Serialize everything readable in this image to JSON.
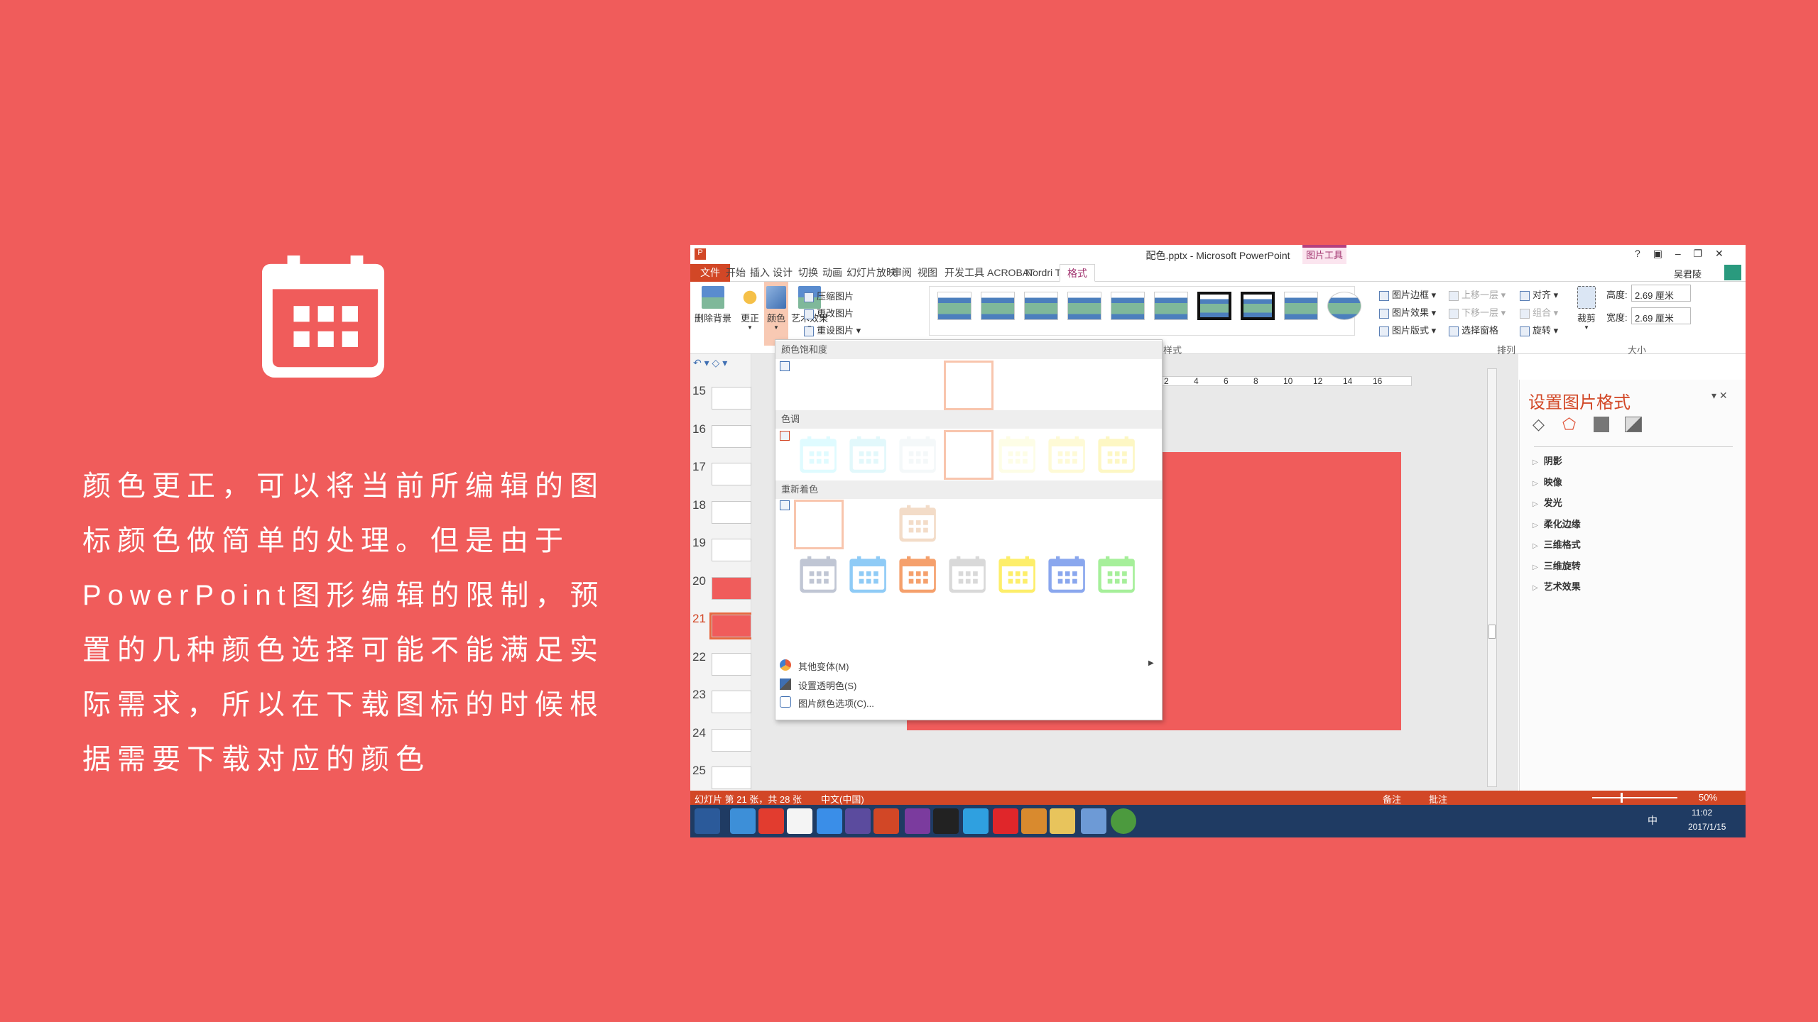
{
  "left": {
    "icon": "calendar-icon",
    "lines": [
      "颜色更正，可以将当前所编辑的图",
      "标颜色做简单的处理。但是由于",
      "PowerPoint图形编辑的限制，预",
      "置的几种颜色选择可能不能满足实",
      "际需求，所以在下载图标的时候根",
      "据需要下载对应的颜色"
    ]
  },
  "window": {
    "title": "配色.pptx - Microsoft PowerPoint",
    "context_tab": "图片工具",
    "controls": [
      "?",
      "▣",
      "–",
      "❐",
      "✕"
    ],
    "user": "吴君陵",
    "tabs": [
      "文件",
      "开始",
      "插入",
      "设计",
      "切换",
      "动画",
      "幻灯片放映",
      "审阅",
      "视图",
      "开发工具",
      "ACROBAT",
      "Nordri Tools",
      "格式"
    ],
    "ribbon": {
      "remove_bg": "删除背景",
      "corrections": "更正",
      "color": "颜色",
      "artistic": "艺术效果",
      "compress": "压缩图片",
      "change": "更改图片",
      "reset": "重设图片",
      "border": "图片边框",
      "effects": "图片效果",
      "layout": "图片版式",
      "forward": "上移一层",
      "backward": "下移一层",
      "selection": "选择窗格",
      "align": "对齐",
      "group": "组合",
      "rotate": "旋转",
      "crop": "裁剪",
      "height_label": "高度:",
      "height_value": "2.69 厘米",
      "width_label": "宽度:",
      "width_value": "2.69 厘米",
      "group_styles": "图片样式",
      "group_arrange": "排列",
      "group_size": "大小"
    },
    "ruler": [
      "2",
      "4",
      "6",
      "8",
      "10",
      "12",
      "14",
      "16"
    ],
    "slides": [
      "15",
      "16",
      "17",
      "18",
      "19",
      "20",
      "21",
      "22",
      "23",
      "24",
      "25"
    ],
    "current_slide": "21",
    "color_menu": {
      "saturation": "颜色饱和度",
      "tone": "色调",
      "recolor": "重新着色",
      "tone_colors": [
        "#dffbff",
        "#e2f8fb",
        "#f4f8f9",
        "",
        "#fdfde6",
        "#fefad6",
        "#fdf7c4"
      ],
      "recolor_top": "#f3dcc8",
      "recolor_colors": [
        "#c0c6d4",
        "#8fcbf6",
        "#f5a06c",
        "#d9d9d9",
        "#fdee6a",
        "#8aa7ee",
        "#a6ef9a"
      ],
      "items": [
        "其他变体(M)",
        "设置透明色(S)",
        "图片颜色选项(C)..."
      ]
    },
    "format_pane": {
      "title": "设置图片格式",
      "items": [
        "阴影",
        "映像",
        "发光",
        "柔化边缘",
        "三维格式",
        "三维旋转",
        "艺术效果"
      ]
    },
    "status": {
      "slide": "幻灯片 第 21 张，共 28 张",
      "lang": "中文(中国)",
      "notes": "备注",
      "comments": "批注",
      "zoom": "50%",
      "zoom_percent": 50
    },
    "taskbar": {
      "apps": [
        "windows-start",
        "internet-explorer",
        "netease-music",
        "wps",
        "pen-app",
        "eclipse",
        "powerpoint",
        "onenote",
        "qq",
        "browser-app",
        "xmind",
        "gem-app",
        "file-explorer",
        "calculator",
        "chrome"
      ],
      "app_colors": [
        "#2b5a9a",
        "#3d8fd8",
        "#e23c2f",
        "#f4f4f4",
        "#3a8ee8",
        "#5b4b9e",
        "#d24726",
        "#7b3b9e",
        "#222",
        "#2fa0e0",
        "#e0262a",
        "#d98a2e",
        "#e8c45c",
        "#6d9ad6",
        "#4c9a3e"
      ],
      "ime": "中",
      "time": "11:02",
      "date": "2017/1/15"
    },
    "colors": {
      "background": "#f05c5b",
      "accent": "#d24726",
      "taskbar": "#1f3b63"
    }
  }
}
